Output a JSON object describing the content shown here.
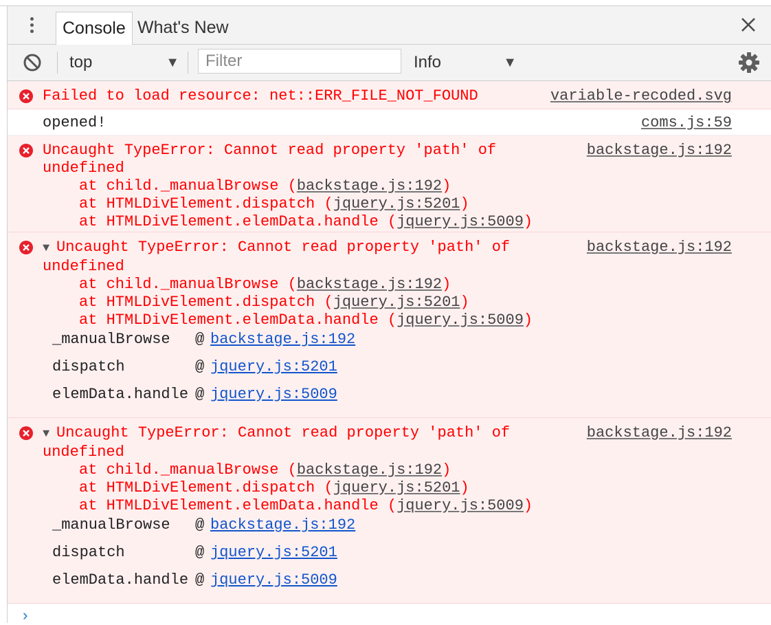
{
  "tabs": {
    "console": "Console",
    "whats_new": "What's New"
  },
  "toolbar": {
    "context": "top",
    "filter_placeholder": "Filter",
    "level": "Info"
  },
  "messages": [
    {
      "type": "error",
      "text": "Failed to load resource: net::ERR_FILE_NOT_FOUND",
      "source": "variable-recoded.svg"
    },
    {
      "type": "log",
      "text": "opened!",
      "source": "coms.js:59"
    },
    {
      "type": "error",
      "expandable": false,
      "text_line1": "Uncaught TypeError: Cannot read property 'path' of",
      "text_line2": "undefined",
      "source": "backstage.js:192",
      "stack": [
        {
          "prefix": "at child._manualBrowse (",
          "link": "backstage.js:192",
          "suffix": ")"
        },
        {
          "prefix": "at HTMLDivElement.dispatch (",
          "link": "jquery.js:5201",
          "suffix": ")"
        },
        {
          "prefix": "at HTMLDivElement.elemData.handle (",
          "link": "jquery.js:5009",
          "suffix": ")"
        }
      ]
    },
    {
      "type": "error",
      "expandable": true,
      "text_line1": "Uncaught TypeError: Cannot read property 'path' of",
      "text_line2": "undefined",
      "source": "backstage.js:192",
      "stack": [
        {
          "prefix": "at child._manualBrowse (",
          "link": "backstage.js:192",
          "suffix": ")"
        },
        {
          "prefix": "at HTMLDivElement.dispatch (",
          "link": "jquery.js:5201",
          "suffix": ")"
        },
        {
          "prefix": "at HTMLDivElement.elemData.handle (",
          "link": "jquery.js:5009",
          "suffix": ")"
        }
      ],
      "trace": [
        {
          "fn": "_manualBrowse",
          "at": "@",
          "link": "backstage.js:192"
        },
        {
          "fn": "dispatch",
          "at": "@",
          "link": "jquery.js:5201"
        },
        {
          "fn": "elemData.handle",
          "at": "@",
          "link": "jquery.js:5009"
        }
      ]
    },
    {
      "type": "error",
      "expandable": true,
      "text_line1": "Uncaught TypeError: Cannot read property 'path' of",
      "text_line2": "undefined",
      "source": "backstage.js:192",
      "stack": [
        {
          "prefix": "at child._manualBrowse (",
          "link": "backstage.js:192",
          "suffix": ")"
        },
        {
          "prefix": "at HTMLDivElement.dispatch (",
          "link": "jquery.js:5201",
          "suffix": ")"
        },
        {
          "prefix": "at HTMLDivElement.elemData.handle (",
          "link": "jquery.js:5009",
          "suffix": ")"
        }
      ],
      "trace": [
        {
          "fn": "_manualBrowse",
          "at": "@",
          "link": "backstage.js:192"
        },
        {
          "fn": "dispatch",
          "at": "@",
          "link": "jquery.js:5201"
        },
        {
          "fn": "elemData.handle",
          "at": "@",
          "link": "jquery.js:5009"
        }
      ]
    }
  ],
  "prompt": "›",
  "icons": {
    "menu": "kebab-menu-icon",
    "close": "close-icon",
    "clear": "clear-console-icon",
    "dropdown": "dropdown-arrow-icon",
    "settings": "gear-icon",
    "error": "error-icon",
    "expand": "expand-triangle-icon"
  },
  "colors": {
    "error_text": "#ff0000",
    "error_bg": "#fff0f0",
    "link_blue": "#1155cc",
    "toolbar_bg": "#f3f3f3"
  }
}
